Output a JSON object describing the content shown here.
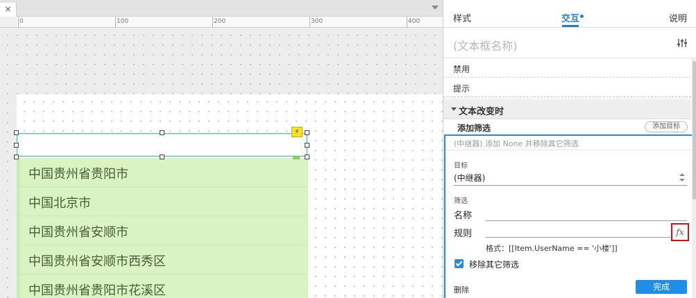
{
  "canvas": {
    "close_glyph": "×",
    "ruler_labels": [
      "0",
      "100",
      "200",
      "300",
      "400"
    ],
    "list_items": [
      "中国贵州省贵阳市",
      "中国北京市",
      "中国贵州省安顺市",
      "中国贵州省安顺市西秀区",
      "中国贵州省贵阳市花溪区"
    ],
    "lightning_glyph": "⚡"
  },
  "inspector": {
    "tabs": {
      "style": "样式",
      "interaction": "交互",
      "notes": "说明"
    },
    "widget_name_placeholder": "(文本框名称)",
    "events": [
      "禁用",
      "提示"
    ],
    "section_title": "文本改变时",
    "action_label": "添加筛选",
    "add_target_label": "添加目标",
    "summary": "(中继器) 添加 None 并移除其它筛选",
    "target_label": "目标",
    "target_value": "(中继器)",
    "filter_label": "筛选",
    "name_label": "名称",
    "rule_label": "规则",
    "fx_label": "fx",
    "format_hint": "格式：[[Item.UserName == '小楼']]",
    "remove_others_label": "移除其它筛选",
    "remove_others_checked": true,
    "delete_label": "删除",
    "done_label": "完成"
  },
  "colors": {
    "accent": "#1f7fd0",
    "list_bg": "#d9f3c3",
    "highlight_red": "#d0111a"
  }
}
